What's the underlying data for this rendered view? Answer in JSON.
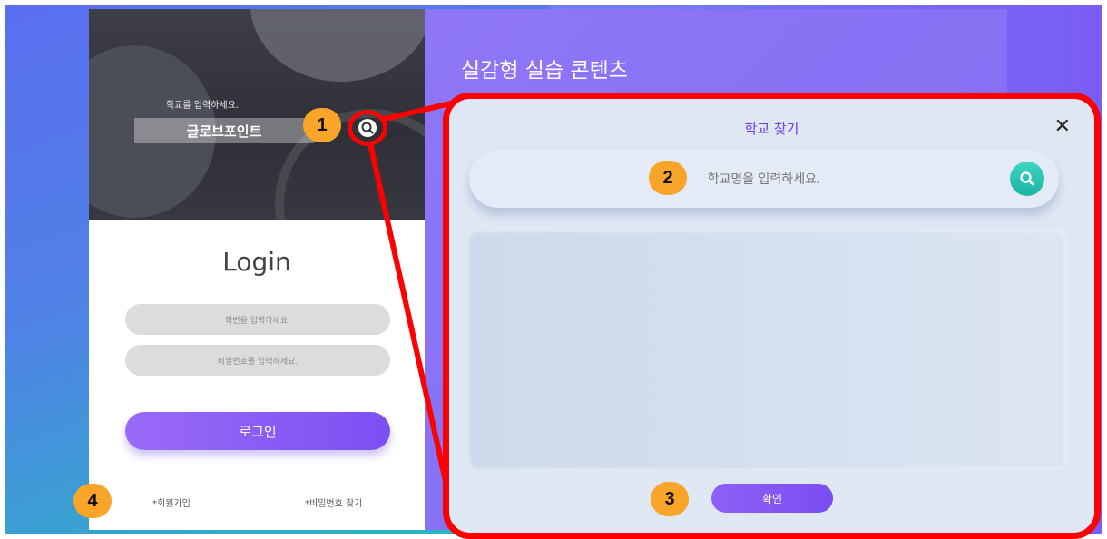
{
  "hero": {
    "prompt": "학교를 입력하세요.",
    "school_value": "글로브포인트"
  },
  "login": {
    "title": "Login",
    "id_placeholder": "학번을 입력하세요.",
    "pw_placeholder": "비밀번호를 입력하세요.",
    "login_button": "로그인",
    "signup_link": "*회원가입",
    "find_pw_link": "*비밀번호 찾기"
  },
  "right_panel": {
    "title": "실감형 실습 콘텐츠"
  },
  "modal": {
    "title": "학교 찾기",
    "close_icon": "close-icon",
    "search_placeholder": "학교명을 입력하세요.",
    "search_icon": "search-icon",
    "confirm_button": "확인"
  },
  "callouts": [
    "1",
    "2",
    "3",
    "4"
  ],
  "colors": {
    "accent": "#7c4ff3",
    "highlight": "#ff0000",
    "badge": "#f8a52a",
    "search_teal": "#1bb5a5"
  }
}
